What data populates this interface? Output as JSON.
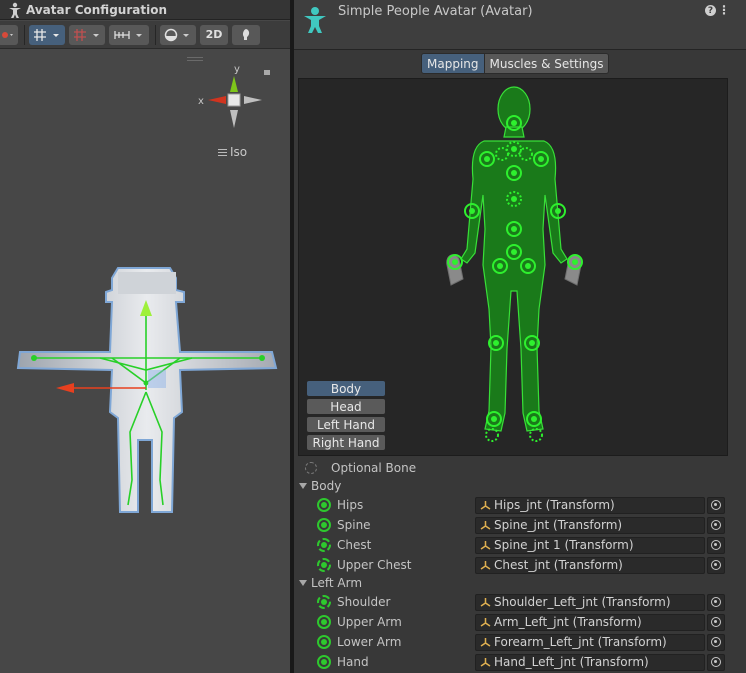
{
  "scene": {
    "title": "Avatar Configuration",
    "toolbar": {
      "mode_2d": "2D"
    },
    "gizmo": {
      "y_label": "y",
      "x_label": "x",
      "view_label": "Iso"
    }
  },
  "inspector": {
    "title": "Simple People Avatar (Avatar)",
    "help": "?",
    "menu": "⋮",
    "tabs": [
      "Mapping",
      "Muscles & Settings"
    ],
    "active_tab": "Mapping",
    "body_parts": [
      "Body",
      "Head",
      "Left Hand",
      "Right Hand"
    ],
    "active_body_part": "Body",
    "legend": {
      "optional_bone": "Optional Bone"
    },
    "groups": [
      {
        "name": "Body",
        "bones": [
          {
            "label": "Hips",
            "value": "Hips_jnt (Transform)",
            "required": true
          },
          {
            "label": "Spine",
            "value": "Spine_jnt (Transform)",
            "required": true
          },
          {
            "label": "Chest",
            "value": "Spine_jnt 1 (Transform)",
            "required": false
          },
          {
            "label": "Upper Chest",
            "value": "Chest_jnt (Transform)",
            "required": false
          }
        ]
      },
      {
        "name": "Left Arm",
        "bones": [
          {
            "label": "Shoulder",
            "value": "Shoulder_Left_jnt (Transform)",
            "required": false
          },
          {
            "label": "Upper Arm",
            "value": "Arm_Left_jnt (Transform)",
            "required": true
          },
          {
            "label": "Lower Arm",
            "value": "Forearm_Left_jnt (Transform)",
            "required": true
          },
          {
            "label": "Hand",
            "value": "Hand_Left_jnt (Transform)",
            "required": true
          }
        ]
      }
    ]
  },
  "colors": {
    "mapped_bone": "#2ec82e",
    "active_button": "#46607c",
    "figure_fill": "#1a7a1a"
  }
}
